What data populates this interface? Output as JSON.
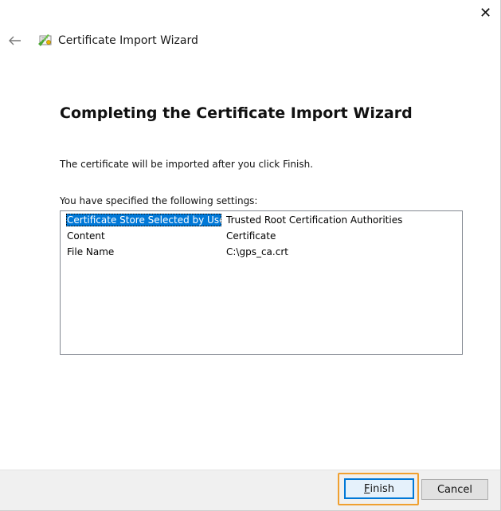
{
  "window": {
    "close_glyph": "✕",
    "title": "Certificate Import Wizard"
  },
  "page": {
    "heading": "Completing the Certificate Import Wizard",
    "description": "The certificate will be imported after you click Finish.",
    "settings_label": "You have specified the following settings:"
  },
  "settings": [
    {
      "key": "Certificate Store Selected by User",
      "value": "Trusted Root Certification Authorities"
    },
    {
      "key": "Content",
      "value": "Certificate"
    },
    {
      "key": "File Name",
      "value": "C:\\gps_ca.crt"
    }
  ],
  "buttons": {
    "finish_mnemonic": "F",
    "finish_rest": "inish",
    "cancel": "Cancel"
  },
  "colors": {
    "selection": "#0078d7",
    "focus_outline": "#f0a030"
  }
}
